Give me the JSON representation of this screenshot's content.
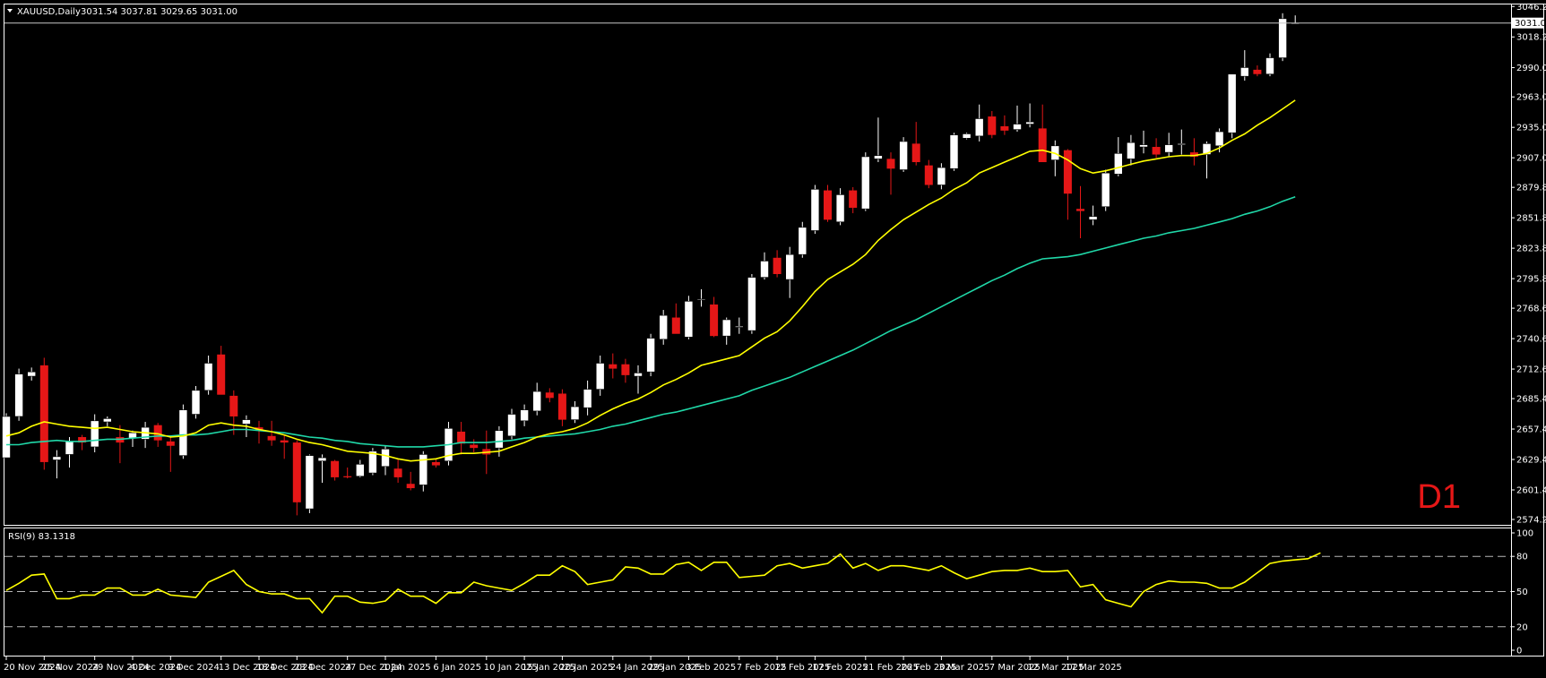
{
  "header": {
    "symbol": "XAUUSD,Daily",
    "ohlc": "3031.54 3037.81 3029.65 3031.00"
  },
  "timeframe_label": "D1",
  "price_tag": "3031.00",
  "rsi_label": "RSI(9) 83.1318",
  "colors": {
    "background": "#000000",
    "bull_candle": "#ffffff",
    "bear_candle": "#e51717",
    "bull_wick": "#ffffff",
    "bear_wick": "#e51717",
    "ma_fast": "#ffff00",
    "ma_slow": "#20d8a8",
    "rsi_line": "#ffff00",
    "axis": "#ffffff"
  },
  "chart_data": [
    {
      "type": "candlestick",
      "title": "XAUUSD,Daily",
      "y_ticks": [
        "3046.20",
        "3018.20",
        "2990.00",
        "2963.00",
        "2935.00",
        "2907.00",
        "2879.80",
        "2851.80",
        "2823.80",
        "2795.80",
        "2768.60",
        "2740.60",
        "2712.60",
        "2685.40",
        "2657.40",
        "2629.40",
        "2601.40",
        "2574.20"
      ],
      "ylim": [
        2574.2,
        3053.0
      ],
      "x_ticks": [
        {
          "label": "20 Nov 2024",
          "index": 0
        },
        {
          "label": "25 Nov 2024",
          "index": 3
        },
        {
          "label": "29 Nov 2024",
          "index": 7
        },
        {
          "label": "4 Dec 2024",
          "index": 10
        },
        {
          "label": "9 Dec 2024",
          "index": 13
        },
        {
          "label": "13 Dec 2024",
          "index": 17
        },
        {
          "label": "18 Dec 2024",
          "index": 20
        },
        {
          "label": "23 Dec 2024",
          "index": 23
        },
        {
          "label": "27 Dec 2024",
          "index": 27
        },
        {
          "label": "1 Jan 2025",
          "index": 30
        },
        {
          "label": "6 Jan 2025",
          "index": 34
        },
        {
          "label": "10 Jan 2025",
          "index": 38
        },
        {
          "label": "15 Jan 2025",
          "index": 41
        },
        {
          "label": "20 Jan 2025",
          "index": 44
        },
        {
          "label": "24 Jan 2025",
          "index": 48
        },
        {
          "label": "29 Jan 2025",
          "index": 51
        },
        {
          "label": "3 Feb 2025",
          "index": 54
        },
        {
          "label": "7 Feb 2025",
          "index": 58
        },
        {
          "label": "12 Feb 2025",
          "index": 61
        },
        {
          "label": "17 Feb 2025",
          "index": 64
        },
        {
          "label": "21 Feb 2025",
          "index": 68
        },
        {
          "label": "26 Feb 2025",
          "index": 71
        },
        {
          "label": "3 Mar 2025",
          "index": 74
        },
        {
          "label": "7 Mar 2025",
          "index": 78
        },
        {
          "label": "12 Mar 2025",
          "index": 81
        },
        {
          "label": "17 Mar 2025",
          "index": 84
        }
      ],
      "ohlc": [
        [
          2631,
          2672,
          2631,
          2669
        ],
        [
          2669,
          2713,
          2665,
          2708
        ],
        [
          2706,
          2714,
          2702,
          2710
        ],
        [
          2716,
          2723,
          2620,
          2627
        ],
        [
          2629,
          2638,
          2612,
          2632
        ],
        [
          2634,
          2650,
          2622,
          2646
        ],
        [
          2650,
          2652,
          2638,
          2645
        ],
        [
          2641,
          2671,
          2636,
          2665
        ],
        [
          2664,
          2669,
          2660,
          2667
        ],
        [
          2650,
          2661,
          2626,
          2645
        ],
        [
          2649,
          2656,
          2641,
          2654
        ],
        [
          2648,
          2664,
          2640,
          2659
        ],
        [
          2661,
          2663,
          2641,
          2647
        ],
        [
          2646,
          2650,
          2618,
          2642
        ],
        [
          2633,
          2680,
          2630,
          2675
        ],
        [
          2671,
          2697,
          2667,
          2693
        ],
        [
          2693,
          2725,
          2689,
          2718
        ],
        [
          2726,
          2734,
          2691,
          2689
        ],
        [
          2688,
          2693,
          2652,
          2669
        ],
        [
          2662,
          2670,
          2650,
          2666
        ],
        [
          2659,
          2665,
          2644,
          2656
        ],
        [
          2651,
          2665,
          2642,
          2647
        ],
        [
          2647,
          2652,
          2630,
          2645
        ],
        [
          2645,
          2647,
          2578,
          2590
        ],
        [
          2584,
          2634,
          2580,
          2633
        ],
        [
          2628,
          2634,
          2608,
          2631
        ],
        [
          2628,
          2629,
          2610,
          2613
        ],
        [
          2614,
          2622,
          2612,
          2613
        ],
        [
          2614,
          2629,
          2613,
          2625
        ],
        [
          2617,
          2640,
          2615,
          2637
        ],
        [
          2623,
          2642,
          2615,
          2639
        ],
        [
          2621,
          2630,
          2608,
          2613
        ],
        [
          2607,
          2618,
          2601,
          2603
        ],
        [
          2606,
          2637,
          2600,
          2634
        ],
        [
          2627,
          2630,
          2622,
          2624
        ],
        [
          2628,
          2664,
          2624,
          2658
        ],
        [
          2655,
          2664,
          2634,
          2644
        ],
        [
          2643,
          2648,
          2636,
          2640
        ],
        [
          2639,
          2656,
          2616,
          2634
        ],
        [
          2640,
          2660,
          2632,
          2656
        ],
        [
          2651,
          2676,
          2648,
          2671
        ],
        [
          2665,
          2680,
          2660,
          2675
        ],
        [
          2674,
          2700,
          2670,
          2692
        ],
        [
          2691,
          2695,
          2682,
          2686
        ],
        [
          2690,
          2694,
          2660,
          2666
        ],
        [
          2666,
          2683,
          2663,
          2678
        ],
        [
          2677,
          2702,
          2670,
          2694
        ],
        [
          2694,
          2725,
          2688,
          2718
        ],
        [
          2717,
          2727,
          2704,
          2713
        ],
        [
          2717,
          2722,
          2700,
          2707
        ],
        [
          2706,
          2716,
          2690,
          2709
        ],
        [
          2710,
          2745,
          2706,
          2741
        ],
        [
          2740,
          2767,
          2735,
          2762
        ],
        [
          2760,
          2773,
          2755,
          2745
        ],
        [
          2742,
          2780,
          2740,
          2775
        ],
        [
          2777,
          2786,
          2770,
          2777
        ],
        [
          2772,
          2779,
          2742,
          2743
        ],
        [
          2743,
          2760,
          2735,
          2758
        ],
        [
          2751,
          2760,
          2745,
          2752
        ],
        [
          2748,
          2800,
          2745,
          2797
        ],
        [
          2797,
          2820,
          2795,
          2812
        ],
        [
          2815,
          2822,
          2797,
          2800
        ],
        [
          2795,
          2825,
          2778,
          2818
        ],
        [
          2818,
          2848,
          2815,
          2843
        ],
        [
          2840,
          2882,
          2837,
          2878
        ],
        [
          2877,
          2882,
          2848,
          2850
        ],
        [
          2848,
          2879,
          2845,
          2873
        ],
        [
          2877,
          2880,
          2856,
          2861
        ],
        [
          2860,
          2912,
          2858,
          2908
        ],
        [
          2906,
          2944,
          2903,
          2909
        ],
        [
          2906,
          2912,
          2873,
          2897
        ],
        [
          2896,
          2926,
          2894,
          2922
        ],
        [
          2920,
          2940,
          2900,
          2903
        ],
        [
          2900,
          2905,
          2879,
          2882
        ],
        [
          2882,
          2902,
          2878,
          2898
        ],
        [
          2897,
          2930,
          2895,
          2928
        ],
        [
          2925,
          2930,
          2924,
          2929
        ],
        [
          2927,
          2956,
          2922,
          2943
        ],
        [
          2945,
          2950,
          2925,
          2928
        ],
        [
          2936,
          2946,
          2928,
          2932
        ],
        [
          2933,
          2955,
          2931,
          2938
        ],
        [
          2938,
          2957,
          2935,
          2940
        ],
        [
          2934,
          2956,
          2906,
          2903
        ],
        [
          2905,
          2923,
          2890,
          2918
        ],
        [
          2914,
          2915,
          2850,
          2874
        ],
        [
          2860,
          2881,
          2833,
          2858
        ],
        [
          2850,
          2863,
          2845,
          2853
        ],
        [
          2862,
          2896,
          2858,
          2893
        ],
        [
          2892,
          2926,
          2890,
          2911
        ],
        [
          2906,
          2928,
          2900,
          2921
        ],
        [
          2917,
          2932,
          2911,
          2919
        ],
        [
          2917,
          2925,
          2907,
          2910
        ],
        [
          2912,
          2930,
          2908,
          2919
        ],
        [
          2919,
          2933,
          2910,
          2920
        ],
        [
          2912,
          2925,
          2900,
          2908
        ],
        [
          2910,
          2922,
          2888,
          2920
        ],
        [
          2918,
          2934,
          2912,
          2931
        ],
        [
          2930,
          2960,
          2925,
          2984
        ],
        [
          2982,
          3006,
          2978,
          2990
        ],
        [
          2988,
          2992,
          2982,
          2984
        ],
        [
          2984,
          3003,
          2982,
          2999
        ],
        [
          2999,
          3040,
          2996,
          3035
        ],
        [
          3031,
          3038,
          3030,
          3031
        ]
      ],
      "ma_fast": [
        2651,
        2654,
        2660,
        2664,
        2662,
        2660,
        2659,
        2658,
        2659,
        2657,
        2655,
        2654,
        2653,
        2650,
        2651,
        2654,
        2661,
        2663,
        2661,
        2660,
        2657,
        2655,
        2652,
        2648,
        2645,
        2643,
        2640,
        2637,
        2636,
        2635,
        2633,
        2630,
        2628,
        2629,
        2630,
        2633,
        2635,
        2635,
        2636,
        2637,
        2641,
        2645,
        2650,
        2653,
        2655,
        2658,
        2663,
        2670,
        2676,
        2681,
        2685,
        2691,
        2698,
        2703,
        2709,
        2716,
        2719,
        2722,
        2725,
        2733,
        2741,
        2747,
        2757,
        2770,
        2784,
        2795,
        2802,
        2809,
        2818,
        2831,
        2841,
        2850,
        2857,
        2864,
        2870,
        2878,
        2884,
        2893,
        2898,
        2903,
        2908,
        2913,
        2914,
        2911,
        2905,
        2897,
        2893,
        2895,
        2898,
        2901,
        2904,
        2906,
        2908,
        2909,
        2909,
        2911,
        2916,
        2923,
        2929,
        2937,
        2944,
        2952,
        2960
      ],
      "ma_slow": [
        2643,
        2643,
        2645,
        2646,
        2647,
        2646,
        2646,
        2647,
        2648,
        2648,
        2649,
        2650,
        2651,
        2651,
        2652,
        2652,
        2653,
        2655,
        2657,
        2657,
        2656,
        2655,
        2654,
        2652,
        2650,
        2649,
        2647,
        2646,
        2644,
        2643,
        2642,
        2641,
        2641,
        2641,
        2642,
        2643,
        2645,
        2645,
        2645,
        2646,
        2647,
        2649,
        2650,
        2651,
        2652,
        2653,
        2655,
        2657,
        2660,
        2662,
        2665,
        2668,
        2671,
        2673,
        2676,
        2679,
        2682,
        2685,
        2688,
        2693,
        2697,
        2701,
        2705,
        2710,
        2715,
        2720,
        2725,
        2730,
        2736,
        2742,
        2748,
        2753,
        2758,
        2764,
        2770,
        2776,
        2782,
        2788,
        2794,
        2799,
        2805,
        2810,
        2814,
        2815,
        2816,
        2818,
        2821,
        2824,
        2827,
        2830,
        2833,
        2835,
        2838,
        2840,
        2842,
        2845,
        2848,
        2851,
        2855,
        2858,
        2862,
        2867,
        2871
      ]
    },
    {
      "type": "line",
      "title": "RSI(9) 83.1318",
      "ylim": [
        0,
        100
      ],
      "y_ticks": [
        "100",
        "80",
        "50",
        "20",
        "0"
      ],
      "levels": [
        80,
        50,
        20
      ],
      "series": [
        {
          "values": [
            51,
            57,
            64,
            65,
            44,
            44,
            47,
            47,
            53,
            53,
            47,
            47,
            52,
            47,
            46,
            45,
            58,
            63,
            68,
            56,
            50,
            48,
            48,
            44,
            44,
            32,
            46,
            46,
            41,
            40,
            42,
            52,
            46,
            46,
            40,
            49,
            49,
            58,
            55,
            53,
            51,
            57,
            64,
            64,
            72,
            67,
            56,
            58,
            60,
            71,
            70,
            65,
            65,
            73,
            75,
            68,
            75,
            75,
            62,
            63,
            64,
            72,
            74,
            70,
            72,
            74,
            82,
            70,
            74,
            68,
            72,
            72,
            70,
            68,
            72,
            66,
            61,
            64,
            67,
            68,
            68,
            70,
            67,
            67,
            68,
            54,
            56,
            43,
            40,
            37,
            50,
            56,
            59,
            58,
            58,
            57,
            53,
            53,
            58,
            66,
            74,
            76,
            77,
            78,
            83
          ]
        }
      ]
    }
  ]
}
